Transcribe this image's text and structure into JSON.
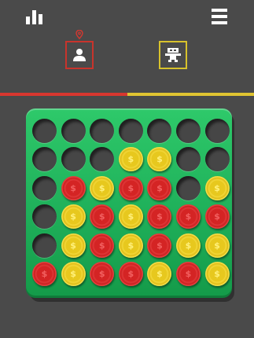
{
  "header": {
    "stats_icon": "bar-chart-icon",
    "menu_icon": "hamburger-menu-icon"
  },
  "players": [
    {
      "name": "human",
      "icon": "person-icon",
      "color": "#c8342c",
      "active": true
    },
    {
      "name": "robot",
      "icon": "robot-icon",
      "color": "#d8c22c",
      "active": false
    }
  ],
  "turn_indicator": {
    "icon": "location-pin-icon",
    "player": "human"
  },
  "progress": {
    "red_fraction": 0.5,
    "red_color": "#d8372f",
    "yellow_color": "#e0c431"
  },
  "board": {
    "rows": 6,
    "cols": 7,
    "background": "#1fb05a",
    "coin_symbol": "$",
    "grid": [
      [
        "E",
        "E",
        "E",
        "E",
        "E",
        "E",
        "E"
      ],
      [
        "E",
        "E",
        "E",
        "Y",
        "Y",
        "E",
        "E"
      ],
      [
        "E",
        "R",
        "Y",
        "R",
        "R",
        "E",
        "Y"
      ],
      [
        "E",
        "Y",
        "R",
        "Y",
        "R",
        "R",
        "R"
      ],
      [
        "E",
        "Y",
        "R",
        "Y",
        "R",
        "Y",
        "Y"
      ],
      [
        "R",
        "Y",
        "R",
        "R",
        "Y",
        "R",
        "Y"
      ]
    ]
  }
}
